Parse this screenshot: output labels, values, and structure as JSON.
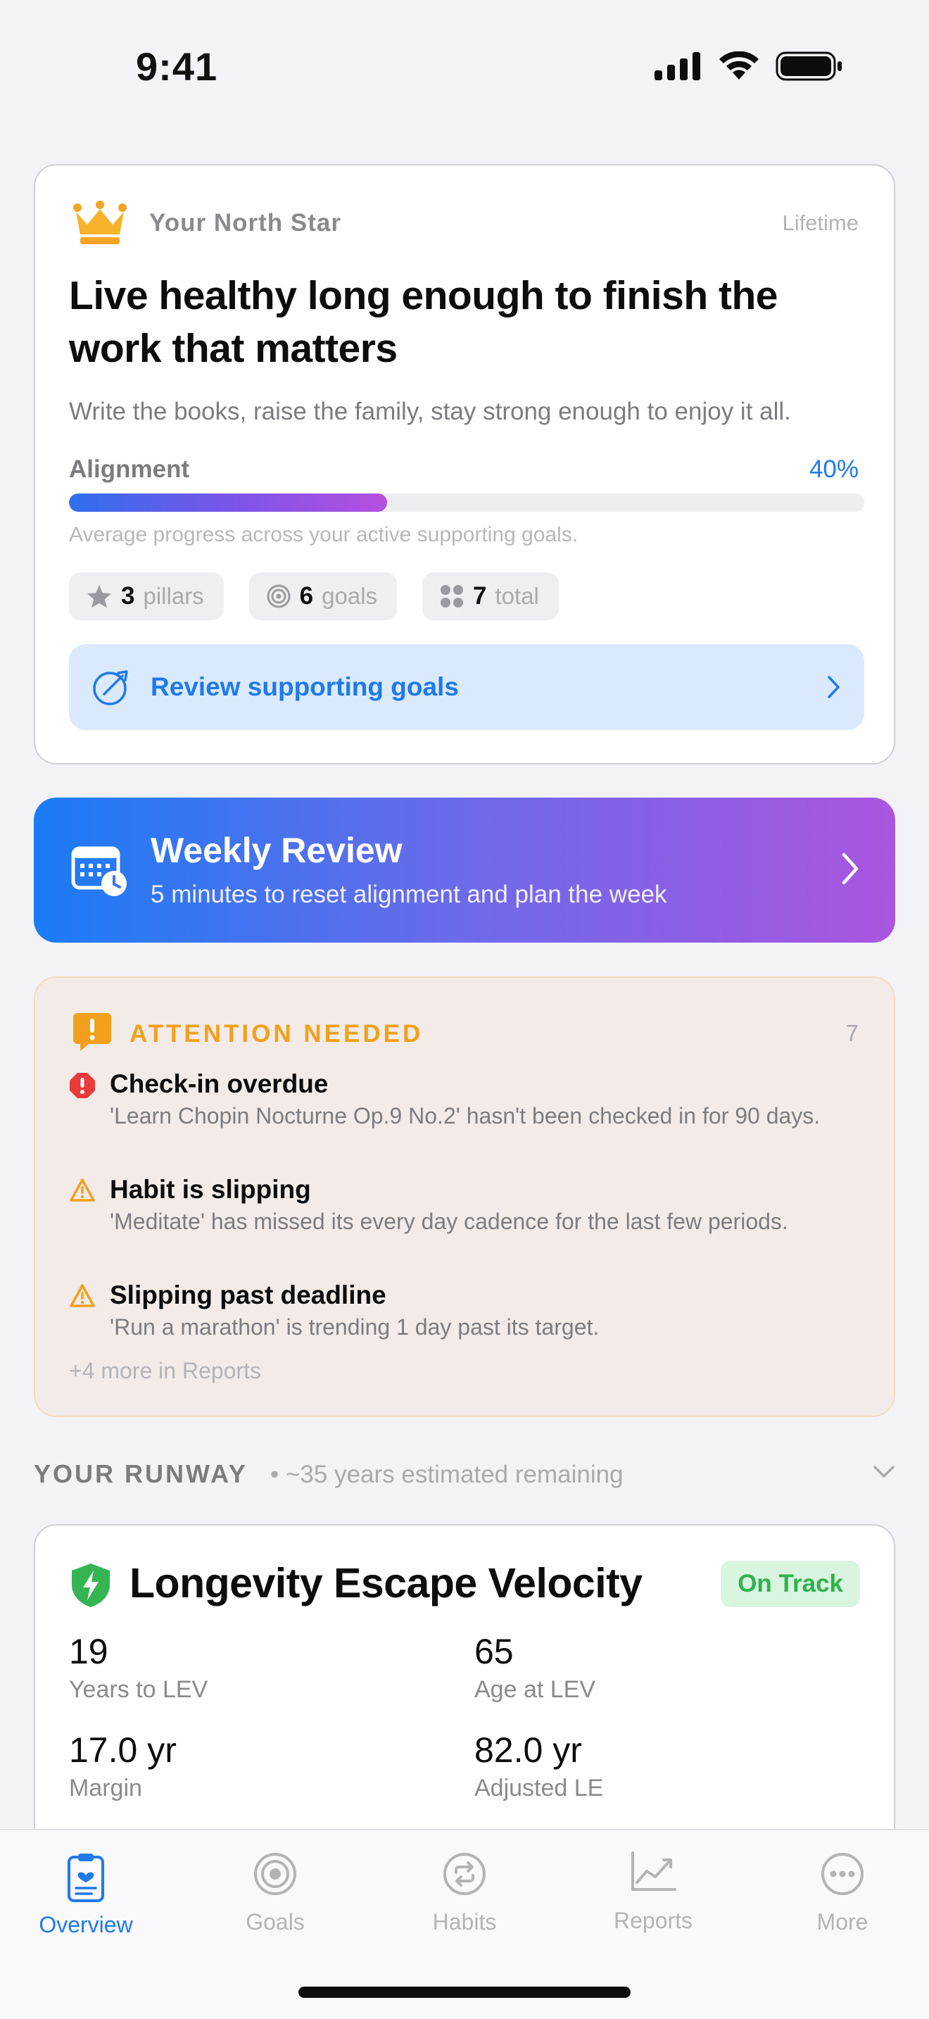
{
  "status": {
    "time": "9:41"
  },
  "north_star": {
    "label": "Your North Star",
    "term": "Lifetime",
    "title": "Live healthy long enough to finish the work that matters",
    "subtitle": "Write the books, raise the family, stay strong enough to enjoy it all.",
    "alignment_label": "Alignment",
    "alignment_pct": "40%",
    "alignment_value": 0.4,
    "caption": "Average progress across your active supporting goals.",
    "chips": [
      {
        "icon": "star-icon",
        "num": "3",
        "label": "pillars"
      },
      {
        "icon": "target-icon",
        "num": "6",
        "label": "goals"
      },
      {
        "icon": "grid-dots-icon",
        "num": "7",
        "label": "total"
      }
    ],
    "review_button": "Review supporting goals"
  },
  "weekly_review": {
    "title": "Weekly Review",
    "subtitle": "5 minutes to reset alignment and plan the week"
  },
  "attention": {
    "title": "ATTENTION NEEDED",
    "count": "7",
    "items": [
      {
        "severity": "error",
        "title": "Check-in overdue",
        "desc": "'Learn Chopin Nocturne Op.9 No.2' hasn't been checked in for 90 days."
      },
      {
        "severity": "warning",
        "title": "Habit is slipping",
        "desc": "'Meditate' has missed its every day cadence for the last few periods."
      },
      {
        "severity": "warning",
        "title": "Slipping past deadline",
        "desc": "'Run a marathon' is trending 1 day past its target."
      }
    ],
    "more": "+4 more in Reports"
  },
  "runway": {
    "title": "YOUR RUNWAY",
    "subtitle": "• ~35 years estimated remaining"
  },
  "lev": {
    "title": "Longevity Escape Velocity",
    "badge": "On Track",
    "stats": [
      {
        "value": "19",
        "label": "Years to LEV"
      },
      {
        "value": "65",
        "label": "Age at LEV"
      },
      {
        "value": "17.0 yr",
        "label": "Margin"
      },
      {
        "value": "82.0 yr",
        "label": "Adjusted LE"
      }
    ]
  },
  "tabs": [
    {
      "label": "Overview",
      "icon": "clipboard-heart-icon",
      "active": true
    },
    {
      "label": "Goals",
      "icon": "target-icon",
      "active": false
    },
    {
      "label": "Habits",
      "icon": "repeat-icon",
      "active": false
    },
    {
      "label": "Reports",
      "icon": "chart-line-icon",
      "active": false
    },
    {
      "label": "More",
      "icon": "ellipsis-circle-icon",
      "active": false
    }
  ],
  "colors": {
    "accent": "#1f7aea",
    "warning": "#f2a01c",
    "error": "#ea3a3a",
    "success": "#2fb24e"
  }
}
